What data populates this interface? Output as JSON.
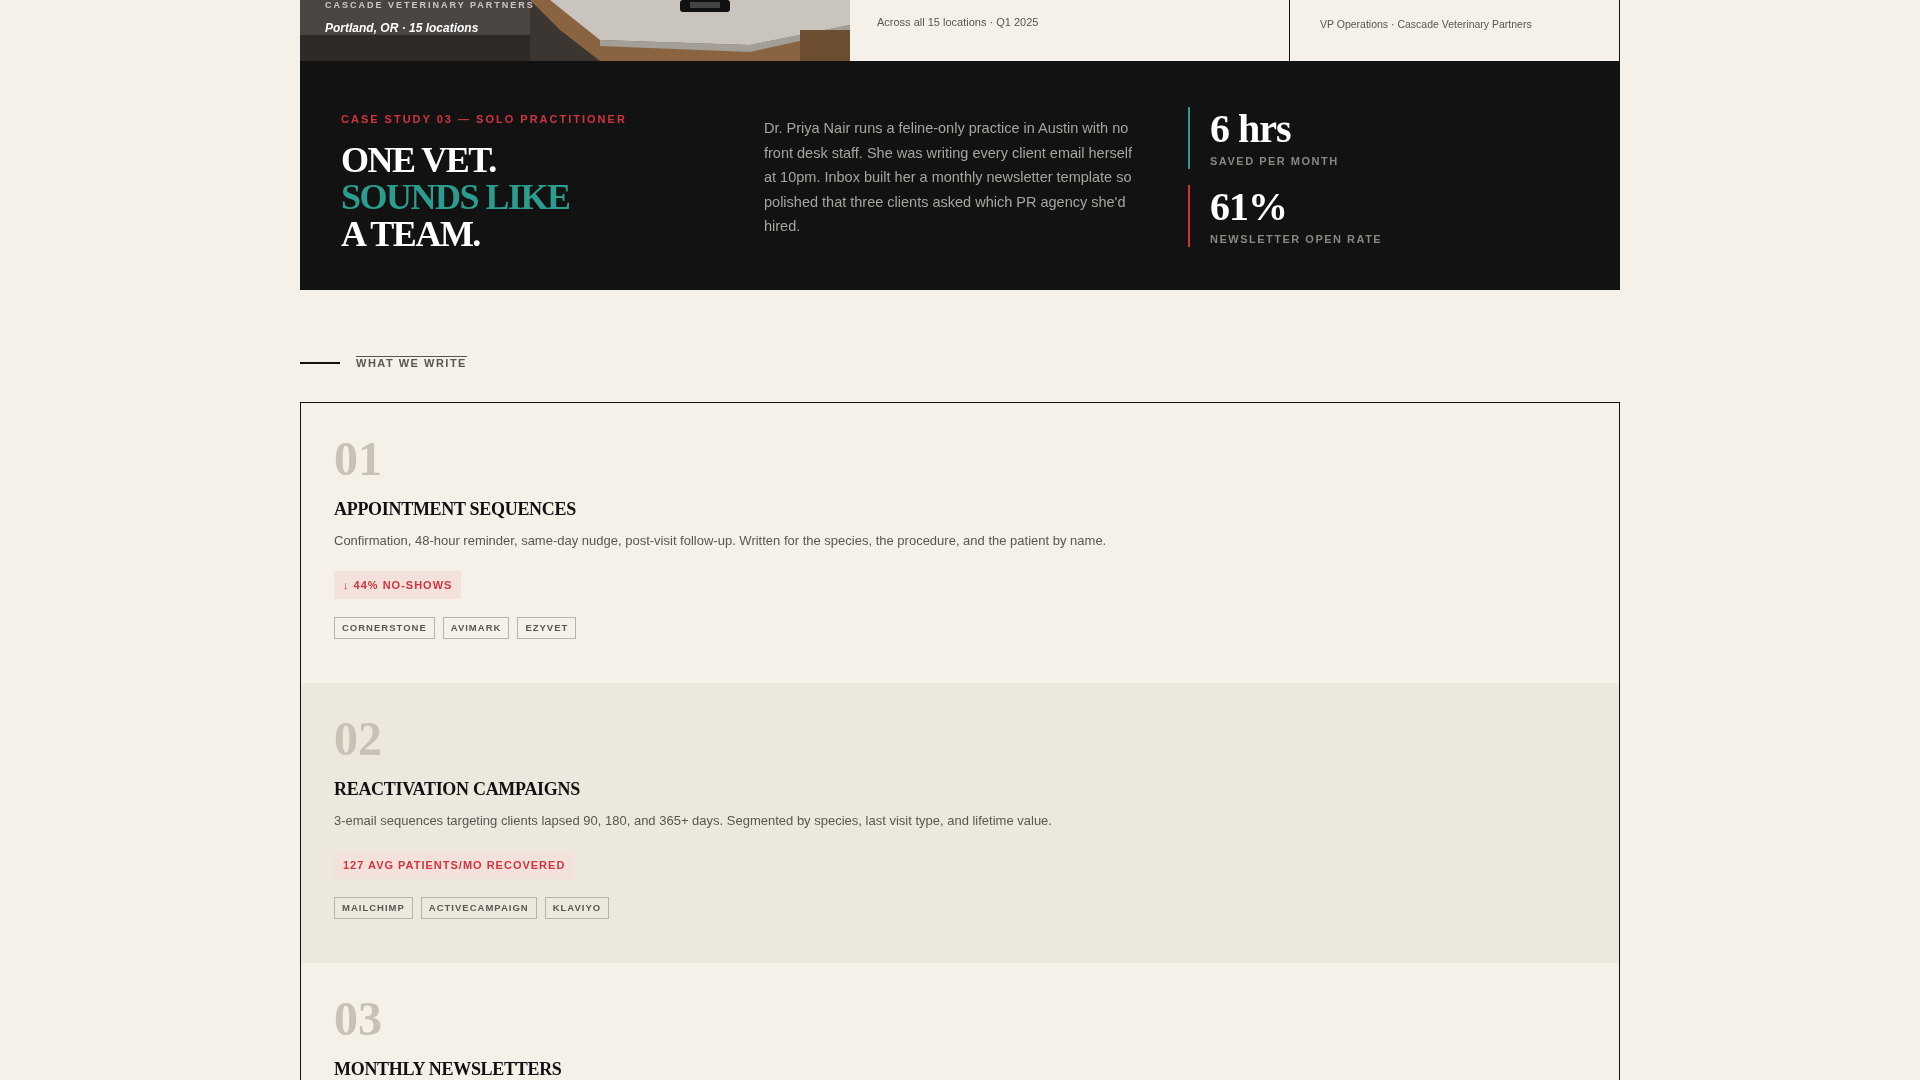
{
  "top_row": {
    "photo": {
      "kind": "picture",
      "eyebrow": "CASCADE VETERINARY PARTNERS",
      "caption": "Portland, OR · 15 locations"
    },
    "cards": [
      {
        "note": "Across all 15 locations · Q1 2025"
      },
      {
        "note": "VP Operations · Cascade Veterinary Partners"
      }
    ]
  },
  "case_study": {
    "eyebrow": "CASE STUDY 03 — SOLO PRACTITIONER",
    "headline": [
      {
        "text": "ONE VET.",
        "accent": false
      },
      {
        "text": "SOUNDS LIKE",
        "accent": true
      },
      {
        "text": "A TEAM.",
        "accent": false
      }
    ],
    "body": "Dr. Priya Nair runs a feline-only practice in Austin with no front desk staff. She was writing every client email herself at 10pm. Inbox built her a monthly newsletter template so polished that three clients asked which PR agency she'd hired.",
    "stats": [
      {
        "value": "6 hrs",
        "label": "SAVED PER MONTH",
        "color": "#2a9d8f"
      },
      {
        "value": "61%",
        "label": "NEWSLETTER OPEN RATE",
        "color": "#d1343e"
      }
    ]
  },
  "section_label": "WHAT WE WRITE",
  "services": [
    {
      "number": "01",
      "title": "APPOINTMENT SEQUENCES",
      "description": "Confirmation, 48-hour reminder, same-day nudge, post-visit follow-up. Written for the species, the procedure, and the patient by name.",
      "result": "↓ 44% NO-SHOWS",
      "tags": [
        "CORNERSTONE",
        "AVIMARK",
        "EZYVET"
      ]
    },
    {
      "number": "02",
      "title": "REACTIVATION CAMPAIGNS",
      "description": "3-email sequences targeting clients lapsed 90, 180, and 365+ days. Segmented by species, last visit type, and lifetime value.",
      "result": "127 AVG PATIENTS/MO RECOVERED",
      "tags": [
        "MAILCHIMP",
        "ACTIVECAMPAIGN",
        "KLAVIYO"
      ]
    },
    {
      "number": "03",
      "title": "MONTHLY NEWSLETTERS"
    }
  ]
}
